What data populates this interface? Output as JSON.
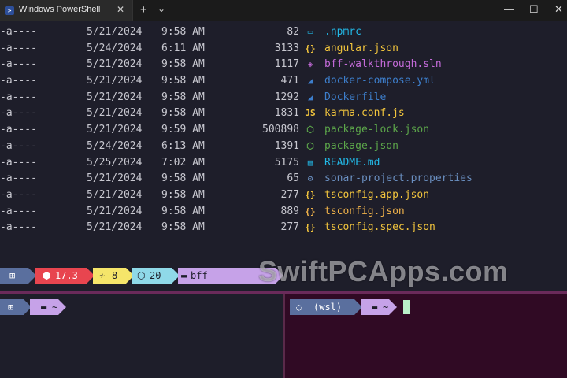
{
  "window": {
    "tab_title": "Windows PowerShell",
    "tab_close": "✕",
    "new_tab": "+",
    "dropdown": "⌄",
    "minimize": "—",
    "maximize": "☐",
    "close": "✕"
  },
  "colors": {
    "cyan": "#22b8e6",
    "yellow": "#f2c53d",
    "purple": "#c46bd9",
    "blue": "#3d7ecb",
    "green": "#5ca64a",
    "gray_blue": "#6a8fc0",
    "orange": "#f0b24a"
  },
  "files": [
    {
      "mode": "-a----",
      "date": "5/21/2024",
      "time": "9:58 AM",
      "length": "82",
      "icon": "▭",
      "name": ".npmrc",
      "color": "#22b8e6"
    },
    {
      "mode": "-a----",
      "date": "5/24/2024",
      "time": "6:11 AM",
      "length": "3133",
      "icon": "{}",
      "name": "angular.json",
      "color": "#f2c53d"
    },
    {
      "mode": "-a----",
      "date": "5/21/2024",
      "time": "9:58 AM",
      "length": "1117",
      "icon": "◈",
      "name": "bff-walkthrough.sln",
      "color": "#c46bd9"
    },
    {
      "mode": "-a----",
      "date": "5/21/2024",
      "time": "9:58 AM",
      "length": "471",
      "icon": "◢",
      "name": "docker-compose.yml",
      "color": "#3d7ecb"
    },
    {
      "mode": "-a----",
      "date": "5/21/2024",
      "time": "9:58 AM",
      "length": "1292",
      "icon": "◢",
      "name": "Dockerfile",
      "color": "#3d7ecb"
    },
    {
      "mode": "-a----",
      "date": "5/21/2024",
      "time": "9:58 AM",
      "length": "1831",
      "icon": "JS",
      "name": "karma.conf.js",
      "color": "#f2c53d"
    },
    {
      "mode": "-a----",
      "date": "5/21/2024",
      "time": "9:59 AM",
      "length": "500898",
      "icon": "⬡",
      "name": "package-lock.json",
      "color": "#5ca64a"
    },
    {
      "mode": "-a----",
      "date": "5/24/2024",
      "time": "6:13 AM",
      "length": "1391",
      "icon": "⬡",
      "name": "package.json",
      "color": "#5ca64a"
    },
    {
      "mode": "-a----",
      "date": "5/25/2024",
      "time": "7:02 AM",
      "length": "5175",
      "icon": "▤",
      "name": "README.md",
      "color": "#22b8e6"
    },
    {
      "mode": "-a----",
      "date": "5/21/2024",
      "time": "9:58 AM",
      "length": "65",
      "icon": "⚙",
      "name": "sonar-project.properties",
      "color": "#6a8fc0"
    },
    {
      "mode": "-a----",
      "date": "5/21/2024",
      "time": "9:58 AM",
      "length": "277",
      "icon": "{}",
      "name": "tsconfig.app.json",
      "color": "#f2c53d"
    },
    {
      "mode": "-a----",
      "date": "5/21/2024",
      "time": "9:58 AM",
      "length": "889",
      "icon": "{}",
      "name": "tsconfig.json",
      "color": "#f0b24a"
    },
    {
      "mode": "-a----",
      "date": "5/21/2024",
      "time": "9:58 AM",
      "length": "277",
      "icon": "{}",
      "name": "tsconfig.spec.json",
      "color": "#f2c53d"
    }
  ],
  "prompt_top": {
    "os_icon": "⊞",
    "angular_icon": "⬢",
    "angular_version": "17.3",
    "git_icon": "≁",
    "git_count": "8",
    "node_icon": "⬡",
    "node_version": "20",
    "folder_icon": "▬",
    "folder": "bff-walkthrough"
  },
  "prompt_left": {
    "os_icon": "⊞",
    "folder_icon": "▬",
    "path": "~"
  },
  "prompt_right": {
    "os_icon": "◌",
    "label": "(wsl)",
    "folder_icon": "▬",
    "path": "~"
  },
  "watermark": "SwiftPCApps.com"
}
